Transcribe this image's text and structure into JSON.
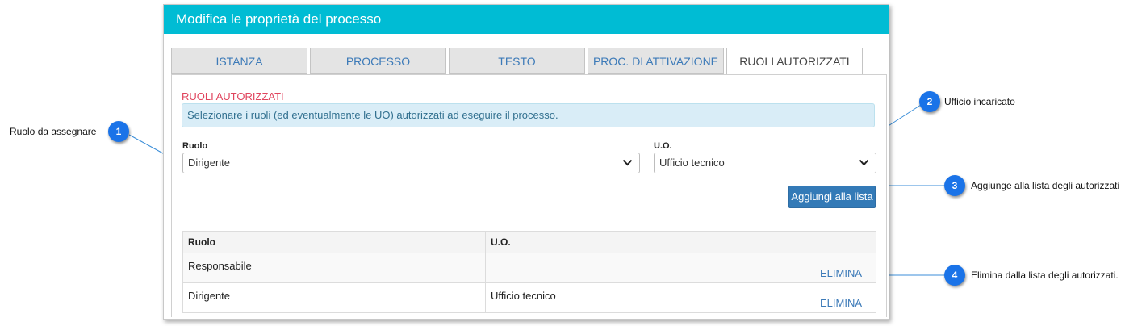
{
  "dialog": {
    "title": "Modifica le proprietà del processo",
    "header_color": "#00bcd4",
    "tabs": [
      {
        "label": "ISTANZA",
        "active": false
      },
      {
        "label": "PROCESSO",
        "active": false
      },
      {
        "label": "TESTO",
        "active": false
      },
      {
        "label": "PROC. DI ATTIVAZIONE",
        "active": false
      },
      {
        "label": "RUOLI AUTORIZZATI",
        "active": true
      }
    ]
  },
  "panel": {
    "section_title": "RUOLI AUTORIZZATI",
    "info_text": "Selezionare i ruoli (ed eventualmente le UO) autorizzati ad eseguire il processo.",
    "ruolo_label": "Ruolo",
    "ruolo_value": "Dirigente",
    "uo_label": "U.O.",
    "uo_value": "Ufficio tecnico",
    "add_button": "Aggiungi alla lista"
  },
  "table": {
    "headers": [
      "Ruolo",
      "U.O.",
      ""
    ],
    "rows": [
      {
        "ruolo": "Responsabile",
        "uo": "",
        "action": "ELIMINA"
      },
      {
        "ruolo": "Dirigente",
        "uo": "Ufficio tecnico",
        "action": "ELIMINA"
      }
    ]
  },
  "annotations": [
    {
      "number": "1",
      "label": "Ruolo da assegnare"
    },
    {
      "number": "2",
      "label": "Ufficio incaricato"
    },
    {
      "number": "3",
      "label": "Aggiunge alla lista degli autorizzati"
    },
    {
      "number": "4",
      "label": "Elimina dalla lista degli autorizzati."
    }
  ],
  "colors": {
    "accent": "#00bcd4",
    "link": "#3c7ab8",
    "button": "#337ab7",
    "section_title": "#e0455e",
    "badge": "#1a73e8"
  },
  "icons": {
    "select_chevron": "chevron-down-icon"
  }
}
